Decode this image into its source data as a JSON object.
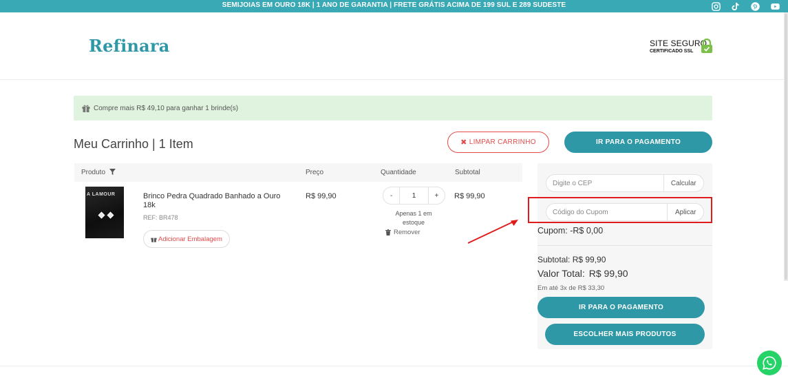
{
  "topbar": {
    "announcement": "SEMIJOIAS EM OURO 18K | 1 ANO DE GARANTIA | FRETE GRÁTIS ACIMA DE 199 SUL E 289 SUDESTE",
    "social": [
      "instagram-icon",
      "tiktok-icon",
      "pinterest-icon",
      "youtube-icon"
    ],
    "color": "#3aa9b6"
  },
  "header": {
    "logo": "Refinara",
    "secure_line1": "SITE SEGURO",
    "secure_line2": "CERTIFICADO SSL",
    "lock_color": "#7cc04a"
  },
  "notice": {
    "text": "Compre mais R$ 49,10 para ganhar 1 brinde(s)",
    "background": "#dff3de"
  },
  "cart": {
    "title": "Meu Carrinho | 1 Item",
    "clear_label": "LIMPAR CARRINHO",
    "clear_icon": "✖",
    "pay_label": "IR PARA O PAGAMENTO",
    "columns": {
      "product": "Produto",
      "price": "Preço",
      "quantity": "Quantidade",
      "subtotal": "Subtotal"
    },
    "item": {
      "image_text": "A LAMOUR",
      "name": "Brinco Pedra Quadrado Banhado a Ouro 18k",
      "ref": "REF: BR478",
      "wrap_label": "Adicionar Embalagem",
      "price": "R$ 99,90",
      "qty": "1",
      "minus": "-",
      "plus": "+",
      "stock": "Apenas 1 em estoque",
      "remove_label": "Remover",
      "subtotal": "R$ 99,90"
    }
  },
  "summary": {
    "cep_placeholder": "Digite o CEP",
    "cep_action": "Calcular",
    "coupon_placeholder": "Código do Cupom",
    "coupon_action": "Aplicar",
    "coupon_line": "Cupom: -R$ 0,00",
    "subtotal_line": "Subtotal: R$ 99,90",
    "total_label": "Valor Total:",
    "total_value": "R$ 99,90",
    "installments": "Em até 3x de R$ 33,30",
    "pay_label": "IR PARA O PAGAMENTO",
    "more_label": "ESCOLHER MAIS PRODUTOS"
  },
  "colors": {
    "accent": "#2f98a6",
    "danger": "#e34a4a",
    "highlight": "#e01b1b",
    "whatsapp": "#25d366"
  }
}
